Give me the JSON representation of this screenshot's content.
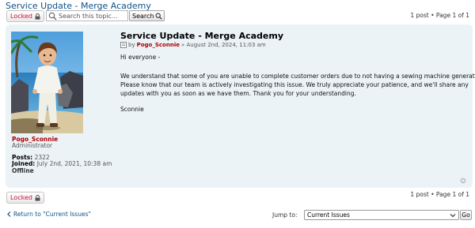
{
  "topic": {
    "title": "Service Update - Merge Academy"
  },
  "actions": {
    "locked_label": "Locked",
    "search_placeholder": "Search this topic...",
    "search_button_label": "Search",
    "pagination_text": "1 post • Page 1 of 1"
  },
  "post": {
    "title": "Service Update - Merge Academy",
    "author": "Pogo_Sconnie",
    "date_prefix": "by",
    "date": "» August 2nd, 2024, 11:03 am",
    "lines": [
      "Hi everyone -",
      "We understand that some of you are unable to complete customer orders due to not having a sewing machine generator.",
      "Please know that our team is actively investigating this issue. We truly appreciate your patience, and we'll share any",
      "updates with you as soon as we have them. Thank you for your understanding.",
      "Sconnie"
    ]
  },
  "profile": {
    "name": "Pogo_Sconnie",
    "rank": "Administrator",
    "posts_label": "Posts:",
    "posts_value": "2322",
    "joined_label": "Joined:",
    "joined_value": "July 2nd, 2021, 10:38 am",
    "status": "Offline"
  },
  "footer": {
    "locked_label": "Locked",
    "pagination_text": "1 post • Page 1 of 1",
    "return_link": "Return to \"Current Issues\"",
    "jump_label": "Jump to:",
    "jump_selected": "Current Issues",
    "go_label": "Go"
  },
  "icons": {
    "lock": "lock-icon",
    "search": "search-icon",
    "post": "post-icon",
    "top": "back-to-top-icon",
    "return": "chevron-left-icon",
    "dropdown": "chevron-down-icon"
  },
  "colors": {
    "link": "#105289",
    "locked": "#d31141",
    "author": "#aa0000",
    "panel": "#ecf3f7"
  }
}
